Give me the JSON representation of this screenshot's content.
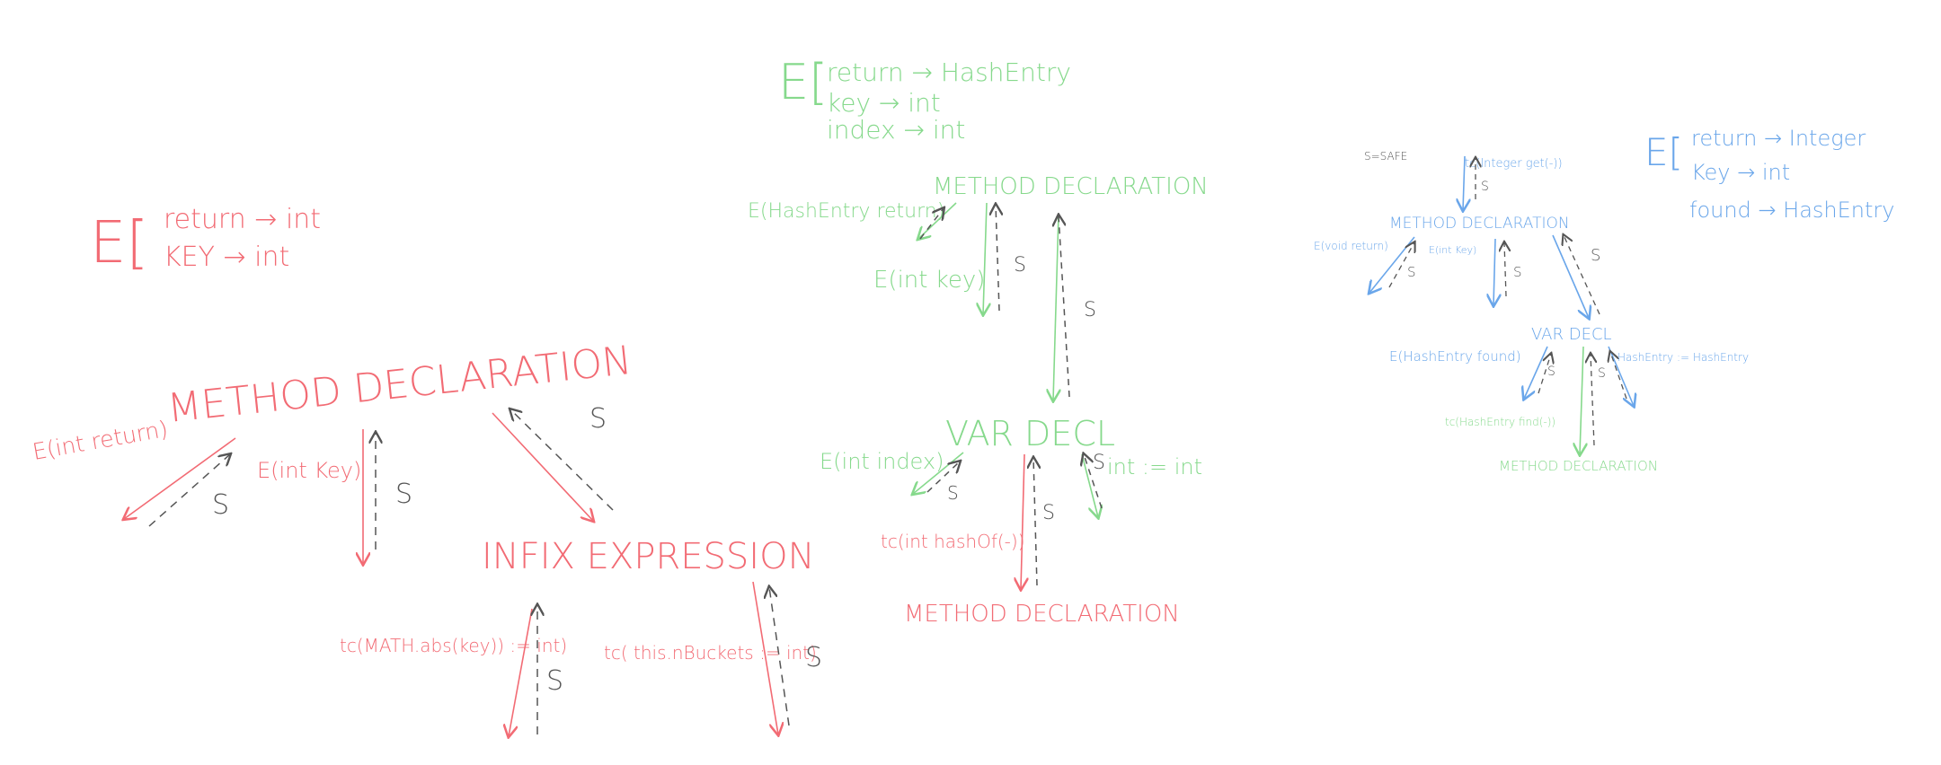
{
  "colors": {
    "red": "#f26b74",
    "green": "#86d98c",
    "blue": "#6aa6ea",
    "gray": "#555555"
  },
  "red_panel": {
    "env": {
      "bracket": "E[",
      "rows": [
        "return → int",
        "KEY → int"
      ]
    },
    "method_decl": "METHOD DECLARATION",
    "env_return": "E(int return)",
    "env_key": "E(int Key)",
    "infix": "INFIX EXPRESSION",
    "tc_left": "tc(MATH.abs(key)) := int)",
    "tc_right": "tc( this.nBuckets := int)",
    "s_label": "S"
  },
  "green_panel": {
    "env": {
      "bracket": "E[",
      "rows": [
        "return → HashEntry",
        "key → int",
        "index → int"
      ]
    },
    "method_decl": "METHOD DECLARATION",
    "env_return": "E(HashEntry return)",
    "env_key": "E(int key)",
    "var_decl": "VAR DECL",
    "env_index": "E(int index)",
    "int_assign": "int := int",
    "tc_hash": "tc(int hashOf(-))",
    "method_decl_bottom": "METHOD DECLARATION",
    "s_label": "S"
  },
  "blue_panel": {
    "env": {
      "bracket": "E[",
      "rows": [
        "return → Integer",
        "Key → int",
        "found → HashEntry"
      ]
    },
    "s_safe": "S=SAFE",
    "tc_top": "tc(Integer get(-))",
    "method_decl": "METHOD DECLARATION",
    "env_return": "E(void return)",
    "env_key": "E(int Key)",
    "var_decl": "VAR DECL",
    "env_found": "E(HashEntry found)",
    "assign": "HashEntry := HashEntry",
    "tc_find": "tc(HashEntry find(-))",
    "method_decl_bottom": "METHOD DECLARATION",
    "s_label": "S"
  }
}
